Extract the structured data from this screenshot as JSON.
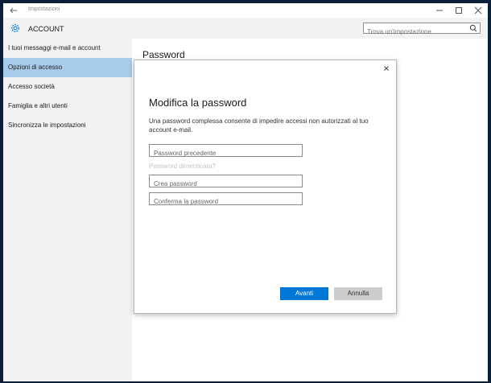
{
  "window": {
    "title": "Impostazioni"
  },
  "header": {
    "section": "ACCOUNT",
    "search_placeholder": "Trova un'impostazione"
  },
  "sidebar": {
    "items": [
      {
        "label": "I tuoi messaggi e-mail e account"
      },
      {
        "label": "Opzioni di accesso",
        "selected": true
      },
      {
        "label": "Accesso società"
      },
      {
        "label": "Famiglia e altri utenti"
      },
      {
        "label": "Sincronizza le impostazioni"
      }
    ]
  },
  "main": {
    "section_title": "Password"
  },
  "dialog": {
    "title": "Modifica la password",
    "description": "Una password complessa consente di impedire accessi non autorizzati al tuo account e-mail.",
    "fields": {
      "old_password_placeholder": "Password precedente",
      "new_password_placeholder": "Crea password",
      "confirm_password_placeholder": "Conferma la password"
    },
    "forgot_link": "Password dimenticata?",
    "primary_button": "Avanti",
    "secondary_button": "Annulla"
  },
  "colors": {
    "accent": "#0078d7",
    "selected_nav": "#a8cbeb",
    "sidebar_bg": "#f2f2f2"
  }
}
